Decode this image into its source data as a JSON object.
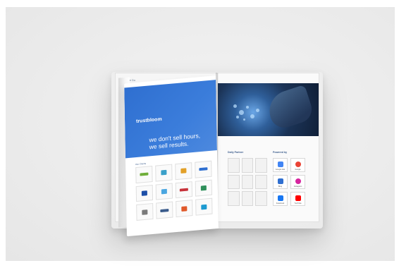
{
  "brochure": {
    "logo": "trustbloom",
    "headline_line1": "we don't sell hours,",
    "headline_line2": "we sell results.",
    "left_caption": "Our Clients",
    "back_left_header": "We Do",
    "right_label_left": "Daily Partner",
    "right_label_right": "Powered by",
    "partners": [
      {
        "name": "google-ads",
        "label": "Google Ads",
        "color": "#4285f4"
      },
      {
        "name": "google",
        "label": "Google",
        "color": "#ea4335"
      },
      {
        "name": "bing",
        "label": "Bing",
        "color": "#2f6fd0"
      },
      {
        "name": "instagram",
        "label": "Instagram",
        "color": "#d6249f"
      },
      {
        "name": "facebook",
        "label": "Facebook",
        "color": "#1877f2"
      },
      {
        "name": "youtube",
        "label": "YouTube",
        "color": "#ff0000"
      }
    ],
    "client_logo_colors": [
      "#6fae3a",
      "#3aa0c9",
      "#e2a028",
      "#2f6fd0",
      "#1d4fa8",
      "#4aa6e0",
      "#c7323a",
      "#2e8f5a",
      "#7a7a7a",
      "#3b5c8c",
      "#e0592a",
      "#1d9bd1"
    ]
  }
}
